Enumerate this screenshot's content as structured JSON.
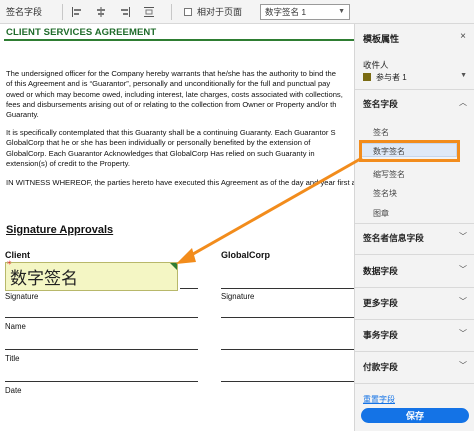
{
  "toolbar": {
    "title": "签名字段",
    "checkbox_label": "相对于页面",
    "selected_field": "数字签名 1",
    "icons": [
      "align-left-icon",
      "align-center-icon",
      "align-right-icon",
      "distribute-icon"
    ]
  },
  "document": {
    "title": "CLIENT SERVICES AGREEMENT",
    "paragraph1": [
      "The undersigned officer for the Company hereby warrants that he/she has the authority to bind the",
      "of this Agreement and is “Guarantor”, personally and unconditionally for the full and punctual pay",
      "owed or which may become owed, including interest, late charges, costs associated with collections,",
      "fees and disbursements arising out of or relating to the collection from Owner or Property and/or th",
      "Guaranty."
    ],
    "paragraph2": [
      "It is specifically contemplated that this Guaranty shall be a continuing Guaranty. Each Guarantor S",
      "GlobalCorp that he or she has been individually or personally benefited by the extension of",
      "GlobalCorp. Each Guarantor Acknowledges that GlobalCorp Has relied on such Guaranty in",
      "extension(s) of credit to the Property."
    ],
    "paragraph3": "IN WITNESS WHEREOF, the parties hereto have executed this Agreement as of the day and year first ab",
    "signature_heading": "Signature Approvals",
    "client_label": "Client",
    "globalcorp_label": "GlobalCorp",
    "signature_field_text": "数字签名",
    "signature_field_required_mark": "*",
    "labels": {
      "signature_left": "Signature",
      "signature_right": "Signature",
      "name": "Name",
      "title": "Title",
      "date": "Date"
    }
  },
  "panel": {
    "heading": "模板属性",
    "close": "×",
    "recipients_label": "收件人",
    "recipient": "参与者 1",
    "recipient_color": "#7a6b12",
    "sections": {
      "signature_fields": "签名字段",
      "signer_info": "签名者信息字段",
      "data_fields": "数据字段",
      "more_fields": "更多字段",
      "transaction_fields": "事务字段",
      "payment_fields": "付款字段"
    },
    "signature_items": [
      "签名",
      "数字签名",
      "缩写签名",
      "签名块",
      "图章"
    ],
    "reset": "重置字段",
    "save": "保存"
  },
  "colors": {
    "accent": "#1473e6",
    "title_green": "#1f6b2a",
    "callout_orange": "#f28c1c",
    "field_fill": "#f4f6c4"
  }
}
